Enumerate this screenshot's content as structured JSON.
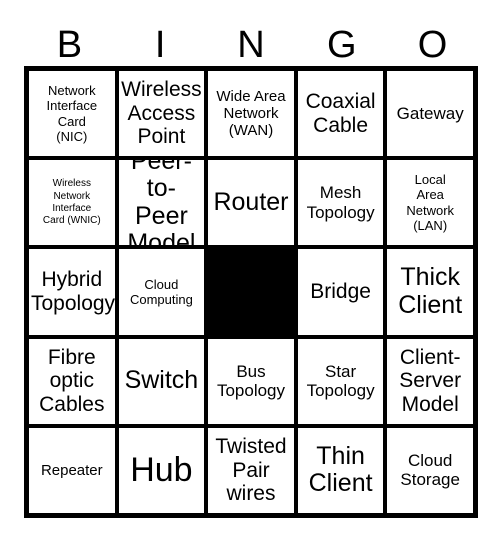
{
  "card": {
    "columns": [
      "B",
      "I",
      "N",
      "G",
      "O"
    ],
    "free_space_label": "",
    "colors": {
      "border": "#000000",
      "cell_background": "#ffffff",
      "free_space_background": "#000000",
      "text": "#000000"
    },
    "cells": [
      {
        "text": "Network\nInterface\nCard\n(NIC)",
        "size": "sm",
        "free": false
      },
      {
        "text": "Wireless\nAccess\nPoint",
        "size": "xl",
        "free": false
      },
      {
        "text": "Wide Area\nNetwork\n(WAN)",
        "size": "md",
        "free": false
      },
      {
        "text": "Coaxial\nCable",
        "size": "xl",
        "free": false
      },
      {
        "text": "Gateway",
        "size": "lg",
        "free": false
      },
      {
        "text": "Wireless\nNetwork\nInterface\nCard (WNIC)",
        "size": "xs",
        "free": false
      },
      {
        "text": "Peer-\nto-Peer\nModel",
        "size": "xxl",
        "free": false
      },
      {
        "text": "Router",
        "size": "xxl",
        "free": false
      },
      {
        "text": "Mesh\nTopology",
        "size": "lg",
        "free": false
      },
      {
        "text": "Local\nArea\nNetwork\n(LAN)",
        "size": "sm",
        "free": false
      },
      {
        "text": "Hybrid\nTopology",
        "size": "xl",
        "free": false
      },
      {
        "text": "Cloud\nComputing",
        "size": "sm",
        "free": false
      },
      {
        "text": "",
        "size": "md",
        "free": true
      },
      {
        "text": "Bridge",
        "size": "xl",
        "free": false
      },
      {
        "text": "Thick\nClient",
        "size": "xxl",
        "free": false
      },
      {
        "text": "Fibre\noptic\nCables",
        "size": "xl",
        "free": false
      },
      {
        "text": "Switch",
        "size": "xxl",
        "free": false
      },
      {
        "text": "Bus\nTopology",
        "size": "lg",
        "free": false
      },
      {
        "text": "Star\nTopology",
        "size": "lg",
        "free": false
      },
      {
        "text": "Client-\nServer\nModel",
        "size": "xl",
        "free": false
      },
      {
        "text": "Repeater",
        "size": "md",
        "free": false
      },
      {
        "text": "Hub",
        "size": "huge",
        "free": false
      },
      {
        "text": "Twisted\nPair\nwires",
        "size": "xl",
        "free": false
      },
      {
        "text": "Thin\nClient",
        "size": "xxl",
        "free": false
      },
      {
        "text": "Cloud\nStorage",
        "size": "lg",
        "free": false
      }
    ]
  }
}
